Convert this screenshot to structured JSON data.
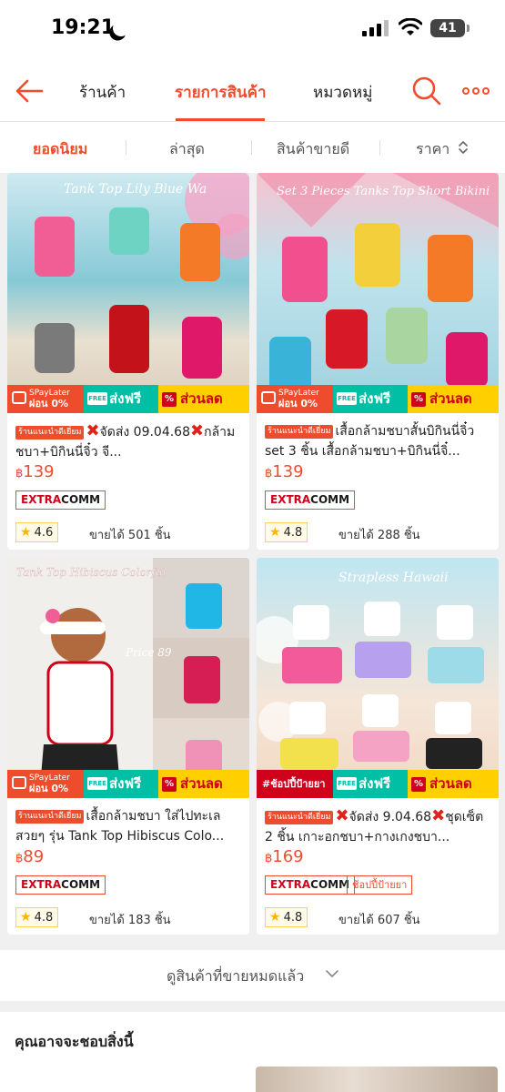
{
  "status_bar": {
    "time": "19:21",
    "battery": "41"
  },
  "header": {
    "tabs": [
      {
        "label": "ร้านค้า"
      },
      {
        "label": "รายการสินค้า"
      },
      {
        "label": "หมวดหมู่"
      }
    ],
    "active_tab": "รายการสินค้า",
    "accent_color": "#ee4d2d"
  },
  "sort": {
    "options": [
      "ยอดนิยม",
      "ล่าสุด",
      "สินค้าขายดี",
      "ราคา"
    ],
    "active": "ยอดนิยม"
  },
  "promo": {
    "paylater_top": "SPayLater",
    "paylater_bottom": "ผ่อน 0%",
    "free_ship": "ส่งฟรี",
    "free_label": "FREE",
    "discount": "ส่วนลด",
    "choppee": "#ช้อปปี้ป้ายยา"
  },
  "products": [
    {
      "image_caption": "Tank Top Lily Blue Wa",
      "badge": "ร้านแนะนำดีเยี่ยม",
      "title_a": "จัดส่ง 09.04.68",
      "title_b": "กล้ามชบา+บิกินนี่จิ๋ว จี...",
      "currency": "฿",
      "price": "139",
      "extracomm_a": "EXTRA",
      "extracomm_b": "COMM",
      "rating": "4.6",
      "sold": "ขายได้ 501 ชิ้น",
      "tag": ""
    },
    {
      "image_caption": "Set 3 Pieces Tanks Top Short Bikini",
      "badge": "ร้านแนะนำดีเยี่ยม",
      "title_a": "เสื้อกล้ามชบาสั้นบิกินนี่จิ๋ว set 3 ชิ้น เสื้อกล้ามชบา+บิกินนี่จิ๋...",
      "title_b": "",
      "currency": "฿",
      "price": "139",
      "extracomm_a": "EXTRA",
      "extracomm_b": "COMM",
      "rating": "4.8",
      "sold": "ขายได้ 288 ชิ้น",
      "tag": ""
    },
    {
      "image_caption": "Tank Top Hibiscus Colorful",
      "image_price": "Price 89",
      "badge": "ร้านแนะนำดีเยี่ยม",
      "title_a": "เสื้อกล้ามชบา ใส่ไปทะเลสวยๆ รุ่น Tank Top Hibiscus Colo...",
      "title_b": "",
      "currency": "฿",
      "price": "89",
      "extracomm_a": "EXTRA",
      "extracomm_b": "COMM",
      "rating": "4.8",
      "sold": "ขายได้ 183 ชิ้น",
      "tag": ""
    },
    {
      "image_caption": "Strapless Hawaii",
      "badge": "ร้านแนะนำดีเยี่ยม",
      "title_a": "จัดส่ง 9.04.68",
      "title_b": "ชุดเซ็ต 2 ชิ้น เกาะอกชบา+กางเกงชบา...",
      "currency": "฿",
      "price": "169",
      "extracomm_a": "EXTRA",
      "extracomm_b": "COMM",
      "rating": "4.8",
      "sold": "ขายได้ 607 ชิ้น",
      "tag": "ช้อปปี้ป้ายยา"
    }
  ],
  "see_all_sold_out": "ดูสินค้าที่ขายหมดแล้ว",
  "suggest_title": "คุณอาจจะชอบสิ่งนี้"
}
